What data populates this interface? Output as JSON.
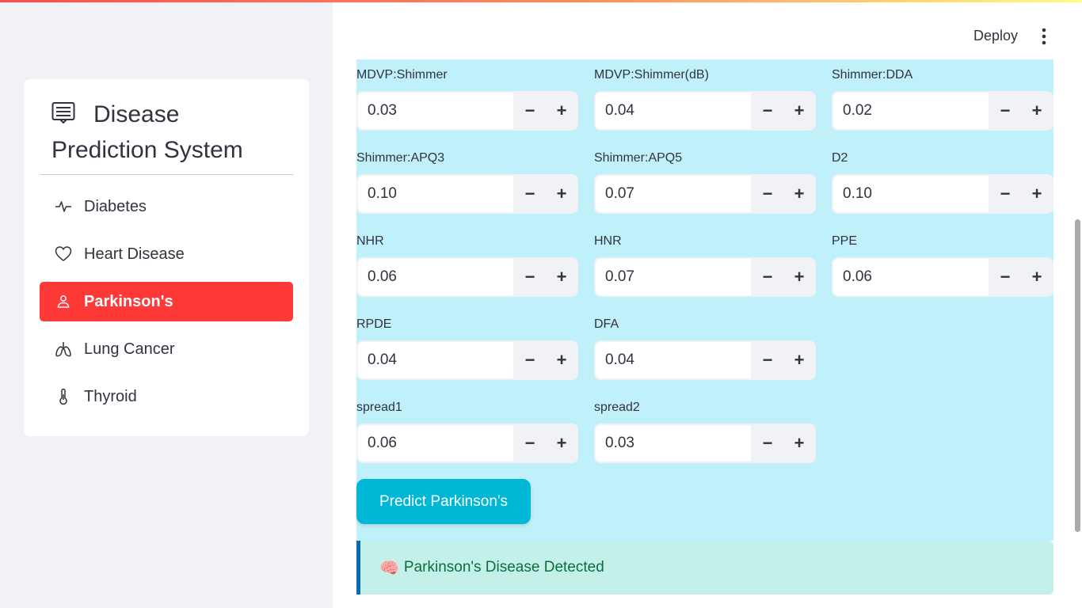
{
  "header": {
    "deploy_label": "Deploy",
    "menu_icon": "kebab-menu-icon"
  },
  "sidebar": {
    "title_line1": "Disease",
    "title_line2": "Prediction System",
    "title_icon": "list-card-icon",
    "accent_color": "#ff3838",
    "items": [
      {
        "label": "Diabetes",
        "icon": "activity-icon",
        "active": false
      },
      {
        "label": "Heart Disease",
        "icon": "heart-icon",
        "active": false
      },
      {
        "label": "Parkinson's",
        "icon": "person-icon",
        "active": true
      },
      {
        "label": "Lung Cancer",
        "icon": "lungs-icon",
        "active": false
      },
      {
        "label": "Thyroid",
        "icon": "thermometer-icon",
        "active": false
      }
    ]
  },
  "fields": [
    {
      "label": "MDVP:Shimmer",
      "value": "0.03"
    },
    {
      "label": "MDVP:Shimmer(dB)",
      "value": "0.04"
    },
    {
      "label": "Shimmer:DDA",
      "value": "0.02"
    },
    {
      "label": "Shimmer:APQ3",
      "value": "0.10"
    },
    {
      "label": "Shimmer:APQ5",
      "value": "0.07"
    },
    {
      "label": "D2",
      "value": "0.10"
    },
    {
      "label": "NHR",
      "value": "0.06"
    },
    {
      "label": "HNR",
      "value": "0.07"
    },
    {
      "label": "PPE",
      "value": "0.06"
    },
    {
      "label": "RPDE",
      "value": "0.04"
    },
    {
      "label": "DFA",
      "value": "0.04"
    },
    {
      "label": "spread1",
      "value": "0.06"
    },
    {
      "label": "spread2",
      "value": "0.03"
    }
  ],
  "stepper": {
    "minus": "−",
    "plus": "+"
  },
  "predict_button": {
    "label": "Predict Parkinson's",
    "color": "#00b7d6"
  },
  "result": {
    "emoji": "🧠",
    "text": "Parkinson's Disease Detected",
    "background": "#c3f0e8"
  }
}
